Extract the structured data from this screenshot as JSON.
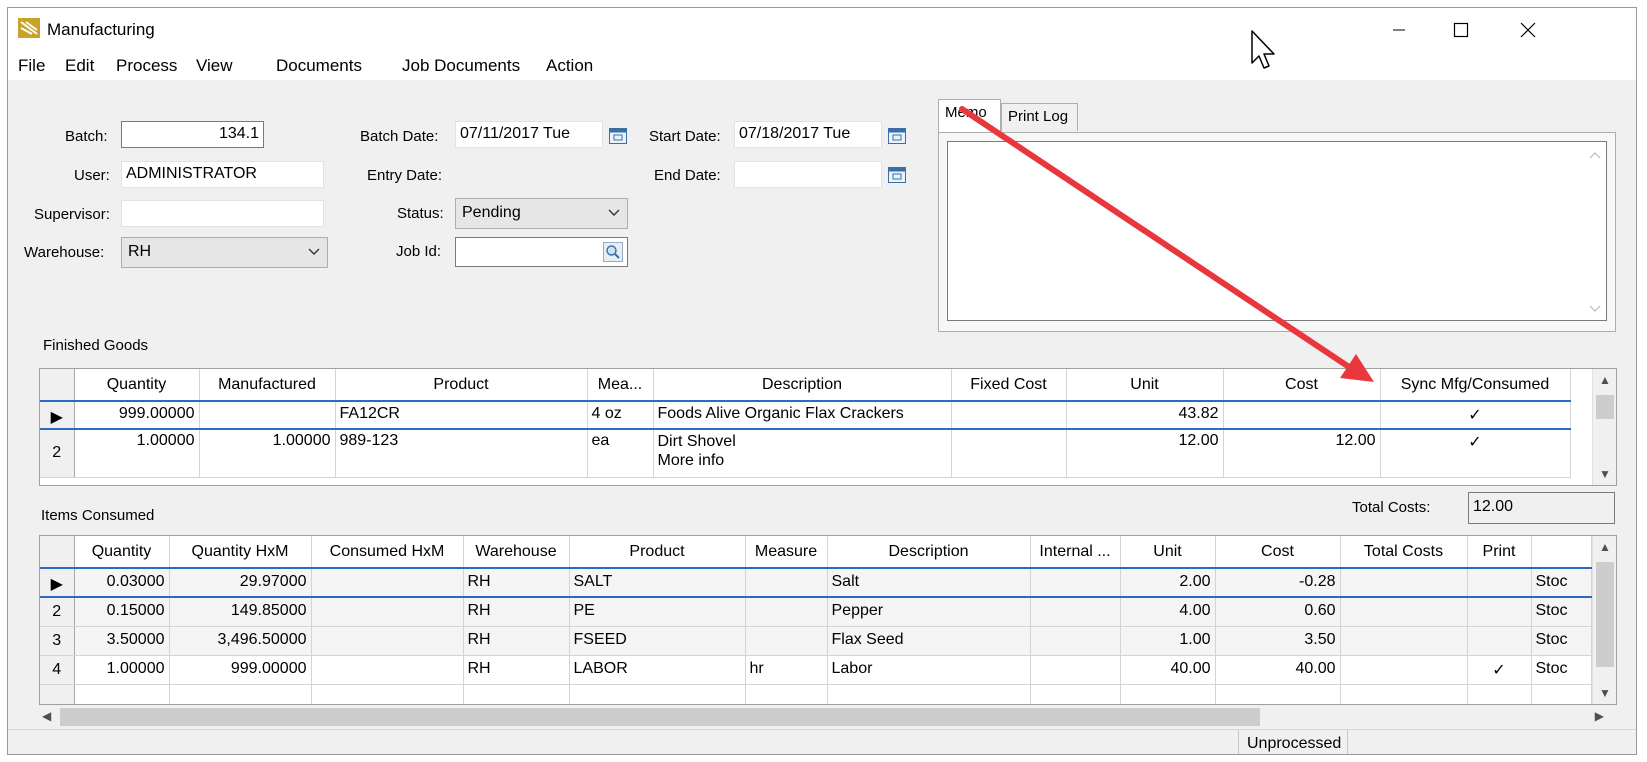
{
  "window": {
    "title": "Manufacturing"
  },
  "menu": [
    "File",
    "Edit",
    "Process",
    "View",
    "Documents",
    "Job Documents",
    "Action"
  ],
  "form": {
    "batch_label": "Batch:",
    "batch_value": "134.1",
    "user_label": "User:",
    "user_value": "ADMINISTRATOR",
    "supervisor_label": "Supervisor:",
    "supervisor_value": "",
    "warehouse_label": "Warehouse:",
    "warehouse_value": "RH",
    "batch_date_label": "Batch Date:",
    "batch_date_value": "07/11/2017 Tue",
    "entry_date_label": "Entry Date:",
    "entry_date_value": "",
    "status_label": "Status:",
    "status_value": "Pending",
    "job_id_label": "Job Id:",
    "job_id_value": "",
    "start_date_label": "Start Date:",
    "start_date_value": "07/18/2017 Tue",
    "end_date_label": "End Date:",
    "end_date_value": ""
  },
  "memo_tabs": [
    "Memo",
    "Print Log"
  ],
  "finished_goods": {
    "title": "Finished Goods",
    "columns": [
      "Quantity",
      "Manufactured",
      "Product",
      "Mea...",
      "Description",
      "Fixed Cost",
      "Unit",
      "Cost",
      "Sync Mfg/Consumed"
    ],
    "rows": [
      {
        "indicator": "▶",
        "quantity": "999.00000",
        "manufactured": "",
        "product": "FA12CR",
        "measure": "4 oz",
        "description": "Foods Alive Organic Flax Crackers",
        "description2": "",
        "fixed_cost": "",
        "unit": "43.82",
        "cost": "",
        "sync": "✓"
      },
      {
        "indicator": "2",
        "quantity": "1.00000",
        "manufactured": "1.00000",
        "product": "989-123",
        "measure": "ea",
        "description": "Dirt Shovel",
        "description2": "More info",
        "fixed_cost": "",
        "unit": "12.00",
        "cost": "12.00",
        "sync": "✓"
      }
    ]
  },
  "total_costs": {
    "label": "Total Costs:",
    "value": "12.00"
  },
  "items_consumed": {
    "title": "Items Consumed",
    "columns": [
      "Quantity",
      "Quantity HxM",
      "Consumed HxM",
      "Warehouse",
      "Product",
      "Measure",
      "Description",
      "Internal ...",
      "Unit",
      "Cost",
      "Total Costs",
      "Print",
      ""
    ],
    "rows": [
      {
        "indicator": "▶",
        "quantity": "0.03000",
        "quantity_hxm": "29.97000",
        "consumed_hxm": "",
        "warehouse": "RH",
        "product": "SALT",
        "measure": "",
        "description": "Salt",
        "internal": "",
        "unit": "2.00",
        "cost": "-0.28",
        "total_costs": "",
        "print": "",
        "extra": "Stoc"
      },
      {
        "indicator": "2",
        "quantity": "0.15000",
        "quantity_hxm": "149.85000",
        "consumed_hxm": "",
        "warehouse": "RH",
        "product": "PE",
        "measure": "",
        "description": "Pepper",
        "internal": "",
        "unit": "4.00",
        "cost": "0.60",
        "total_costs": "",
        "print": "",
        "extra": "Stoc"
      },
      {
        "indicator": "3",
        "quantity": "3.50000",
        "quantity_hxm": "3,496.50000",
        "consumed_hxm": "",
        "warehouse": "RH",
        "product": "FSEED",
        "measure": "",
        "description": "Flax Seed",
        "internal": "",
        "unit": "1.00",
        "cost": "3.50",
        "total_costs": "",
        "print": "",
        "extra": "Stoc"
      },
      {
        "indicator": "4",
        "quantity": "1.00000",
        "quantity_hxm": "999.00000",
        "consumed_hxm": "",
        "warehouse": "RH",
        "product": "LABOR",
        "measure": "hr",
        "description": "Labor",
        "internal": "",
        "unit": "40.00",
        "cost": "40.00",
        "total_costs": "",
        "print": "✓",
        "extra": "Stoc"
      }
    ]
  },
  "status_bar": {
    "status": "Unprocessed"
  },
  "colors": {
    "annotation_arrow": "#e8383d",
    "selection": "#2a6cc4"
  }
}
